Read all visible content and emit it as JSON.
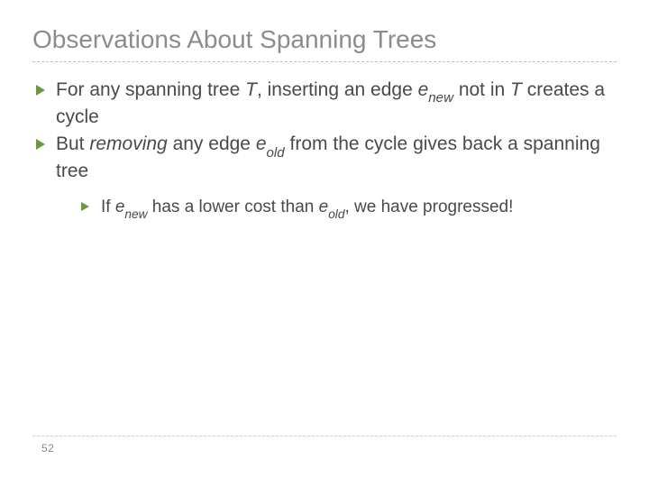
{
  "title": "Observations About Spanning Trees",
  "bullets": [
    {
      "pre1": "For any spanning tree ",
      "T1": "T",
      "mid1": ", inserting an edge ",
      "e1": "e",
      "sub1": "new",
      "mid2": " not in ",
      "T2": "T",
      "post": " creates a cycle"
    },
    {
      "pre1": "But ",
      "rem": "removing",
      "mid1": " any edge ",
      "e1": "e",
      "sub1": "old",
      "post": " from the cycle gives back a spanning tree"
    }
  ],
  "sub_bullet": {
    "pre": "If ",
    "e1": "e",
    "sub1": "new",
    "mid": " has a lower cost than ",
    "e2": "e",
    "sub2": "old",
    "post": ", we have progressed!"
  },
  "page_number": "52"
}
